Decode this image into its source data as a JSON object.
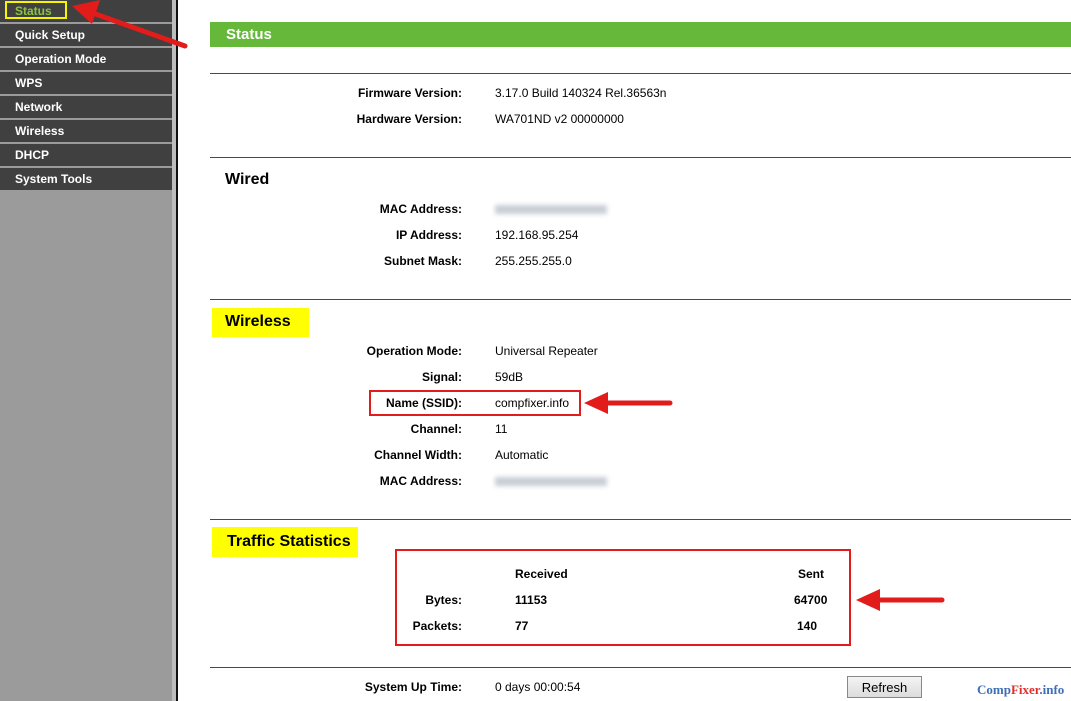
{
  "sidebar": {
    "items": [
      {
        "label": "Status",
        "active": true
      },
      {
        "label": "Quick Setup"
      },
      {
        "label": "Operation Mode"
      },
      {
        "label": "WPS"
      },
      {
        "label": "Network"
      },
      {
        "label": "Wireless"
      },
      {
        "label": "DHCP"
      },
      {
        "label": "System Tools"
      }
    ]
  },
  "header": {
    "title": "Status"
  },
  "firmware": {
    "fw_label": "Firmware Version:",
    "fw_value": "3.17.0 Build 140324 Rel.36563n",
    "hw_label": "Hardware Version:",
    "hw_value": "WA701ND v2 00000000"
  },
  "wired": {
    "title": "Wired",
    "mac_label": "MAC Address:",
    "ip_label": "IP Address:",
    "ip_value": "192.168.95.254",
    "mask_label": "Subnet Mask:",
    "mask_value": "255.255.255.0"
  },
  "wireless": {
    "title": "Wireless",
    "mode_label": "Operation Mode:",
    "mode_value": "Universal Repeater",
    "signal_label": "Signal:",
    "signal_value": "59dB",
    "ssid_label": "Name (SSID):",
    "ssid_value": "compfixer.info",
    "channel_label": "Channel:",
    "channel_value": "11",
    "width_label": "Channel Width:",
    "width_value": "Automatic",
    "mac_label": "MAC Address:"
  },
  "traffic": {
    "title": "Traffic Statistics",
    "received_header": "Received",
    "sent_header": "Sent",
    "bytes_label": "Bytes:",
    "bytes_received": "11153",
    "bytes_sent": "64700",
    "packets_label": "Packets:",
    "packets_received": "77",
    "packets_sent": "140"
  },
  "uptime": {
    "label": "System Up Time:",
    "value": "0 days 00:00:54",
    "refresh_label": "Refresh"
  },
  "watermark": {
    "part1": "Comp",
    "part2": "Fixer",
    "part3": ".info"
  },
  "colors": {
    "accent_green": "#66b83a",
    "highlight": "#ffff00",
    "annotation_red": "#e21b1b"
  }
}
